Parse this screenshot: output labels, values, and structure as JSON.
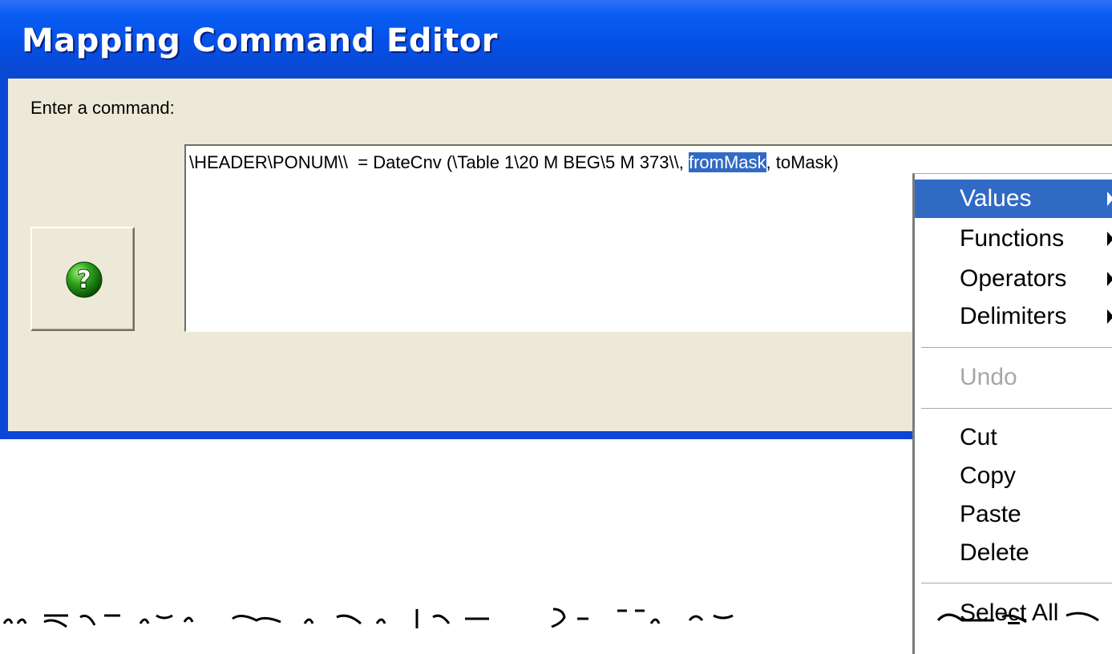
{
  "window": {
    "title": "Mapping Command Editor"
  },
  "editor": {
    "prompt_label": "Enter a command:",
    "command_before": "\\HEADER\\PONUM\\\\  = DateCnv (\\Table 1\\20 M BEG\\5 M 373\\\\, ",
    "command_selected": "fromMask",
    "command_after": ", toMask)"
  },
  "help_button": {
    "icon": "question-mark-icon",
    "color": "#1f8a12"
  },
  "context_menu": {
    "items": [
      {
        "label": "Values",
        "submenu": true,
        "highlighted": true
      },
      {
        "label": "Functions",
        "submenu": true
      },
      {
        "label": "Operators",
        "submenu": true
      },
      {
        "label": "Delimiters",
        "submenu": true
      },
      {
        "label": "Undo",
        "disabled": true
      },
      {
        "label": "Cut"
      },
      {
        "label": "Copy"
      },
      {
        "label": "Paste"
      },
      {
        "label": "Delete"
      },
      {
        "label_pre": "Sele",
        "label_mnemonic": "c",
        "label_post": "t All"
      }
    ]
  },
  "colors": {
    "title_bar": "#0550e6",
    "dialog_face": "#ece9d8",
    "selection": "#316ac5"
  }
}
